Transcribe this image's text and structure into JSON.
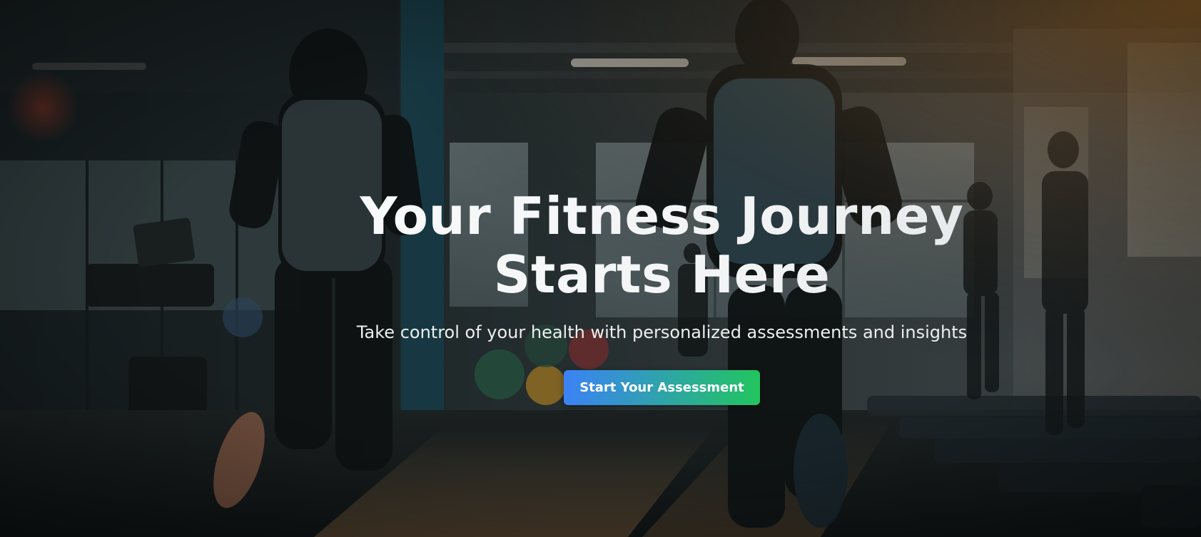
{
  "hero": {
    "title_line1": "Your Fitness Journey",
    "title_line2": "Starts Here",
    "subtitle": "Take control of your health with personalized assessments and insights",
    "cta_label": "Start Your Assessment"
  },
  "colors": {
    "cta_gradient_start": "#3b82f6",
    "cta_gradient_end": "#22c55e",
    "title_text": "#ffffff",
    "subtitle_text": "#eceeef"
  }
}
